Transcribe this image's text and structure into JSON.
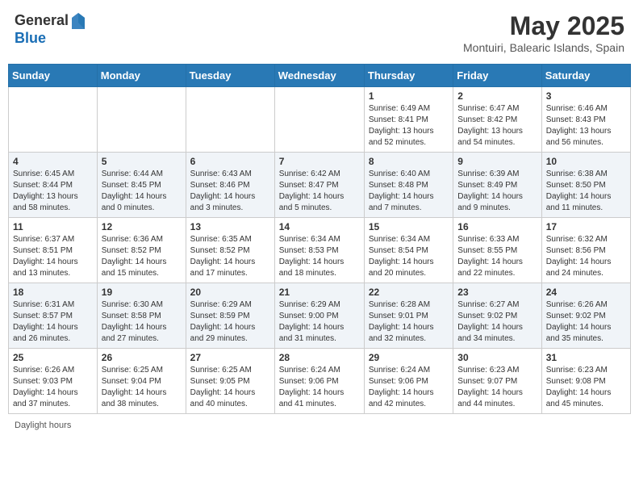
{
  "header": {
    "logo_general": "General",
    "logo_blue": "Blue",
    "month_title": "May 2025",
    "subtitle": "Montuiri, Balearic Islands, Spain"
  },
  "days_of_week": [
    "Sunday",
    "Monday",
    "Tuesday",
    "Wednesday",
    "Thursday",
    "Friday",
    "Saturday"
  ],
  "weeks": [
    [
      {
        "day": "",
        "info": ""
      },
      {
        "day": "",
        "info": ""
      },
      {
        "day": "",
        "info": ""
      },
      {
        "day": "",
        "info": ""
      },
      {
        "day": "1",
        "info": "Sunrise: 6:49 AM\nSunset: 8:41 PM\nDaylight: 13 hours\nand 52 minutes."
      },
      {
        "day": "2",
        "info": "Sunrise: 6:47 AM\nSunset: 8:42 PM\nDaylight: 13 hours\nand 54 minutes."
      },
      {
        "day": "3",
        "info": "Sunrise: 6:46 AM\nSunset: 8:43 PM\nDaylight: 13 hours\nand 56 minutes."
      }
    ],
    [
      {
        "day": "4",
        "info": "Sunrise: 6:45 AM\nSunset: 8:44 PM\nDaylight: 13 hours\nand 58 minutes."
      },
      {
        "day": "5",
        "info": "Sunrise: 6:44 AM\nSunset: 8:45 PM\nDaylight: 14 hours\nand 0 minutes."
      },
      {
        "day": "6",
        "info": "Sunrise: 6:43 AM\nSunset: 8:46 PM\nDaylight: 14 hours\nand 3 minutes."
      },
      {
        "day": "7",
        "info": "Sunrise: 6:42 AM\nSunset: 8:47 PM\nDaylight: 14 hours\nand 5 minutes."
      },
      {
        "day": "8",
        "info": "Sunrise: 6:40 AM\nSunset: 8:48 PM\nDaylight: 14 hours\nand 7 minutes."
      },
      {
        "day": "9",
        "info": "Sunrise: 6:39 AM\nSunset: 8:49 PM\nDaylight: 14 hours\nand 9 minutes."
      },
      {
        "day": "10",
        "info": "Sunrise: 6:38 AM\nSunset: 8:50 PM\nDaylight: 14 hours\nand 11 minutes."
      }
    ],
    [
      {
        "day": "11",
        "info": "Sunrise: 6:37 AM\nSunset: 8:51 PM\nDaylight: 14 hours\nand 13 minutes."
      },
      {
        "day": "12",
        "info": "Sunrise: 6:36 AM\nSunset: 8:52 PM\nDaylight: 14 hours\nand 15 minutes."
      },
      {
        "day": "13",
        "info": "Sunrise: 6:35 AM\nSunset: 8:52 PM\nDaylight: 14 hours\nand 17 minutes."
      },
      {
        "day": "14",
        "info": "Sunrise: 6:34 AM\nSunset: 8:53 PM\nDaylight: 14 hours\nand 18 minutes."
      },
      {
        "day": "15",
        "info": "Sunrise: 6:34 AM\nSunset: 8:54 PM\nDaylight: 14 hours\nand 20 minutes."
      },
      {
        "day": "16",
        "info": "Sunrise: 6:33 AM\nSunset: 8:55 PM\nDaylight: 14 hours\nand 22 minutes."
      },
      {
        "day": "17",
        "info": "Sunrise: 6:32 AM\nSunset: 8:56 PM\nDaylight: 14 hours\nand 24 minutes."
      }
    ],
    [
      {
        "day": "18",
        "info": "Sunrise: 6:31 AM\nSunset: 8:57 PM\nDaylight: 14 hours\nand 26 minutes."
      },
      {
        "day": "19",
        "info": "Sunrise: 6:30 AM\nSunset: 8:58 PM\nDaylight: 14 hours\nand 27 minutes."
      },
      {
        "day": "20",
        "info": "Sunrise: 6:29 AM\nSunset: 8:59 PM\nDaylight: 14 hours\nand 29 minutes."
      },
      {
        "day": "21",
        "info": "Sunrise: 6:29 AM\nSunset: 9:00 PM\nDaylight: 14 hours\nand 31 minutes."
      },
      {
        "day": "22",
        "info": "Sunrise: 6:28 AM\nSunset: 9:01 PM\nDaylight: 14 hours\nand 32 minutes."
      },
      {
        "day": "23",
        "info": "Sunrise: 6:27 AM\nSunset: 9:02 PM\nDaylight: 14 hours\nand 34 minutes."
      },
      {
        "day": "24",
        "info": "Sunrise: 6:26 AM\nSunset: 9:02 PM\nDaylight: 14 hours\nand 35 minutes."
      }
    ],
    [
      {
        "day": "25",
        "info": "Sunrise: 6:26 AM\nSunset: 9:03 PM\nDaylight: 14 hours\nand 37 minutes."
      },
      {
        "day": "26",
        "info": "Sunrise: 6:25 AM\nSunset: 9:04 PM\nDaylight: 14 hours\nand 38 minutes."
      },
      {
        "day": "27",
        "info": "Sunrise: 6:25 AM\nSunset: 9:05 PM\nDaylight: 14 hours\nand 40 minutes."
      },
      {
        "day": "28",
        "info": "Sunrise: 6:24 AM\nSunset: 9:06 PM\nDaylight: 14 hours\nand 41 minutes."
      },
      {
        "day": "29",
        "info": "Sunrise: 6:24 AM\nSunset: 9:06 PM\nDaylight: 14 hours\nand 42 minutes."
      },
      {
        "day": "30",
        "info": "Sunrise: 6:23 AM\nSunset: 9:07 PM\nDaylight: 14 hours\nand 44 minutes."
      },
      {
        "day": "31",
        "info": "Sunrise: 6:23 AM\nSunset: 9:08 PM\nDaylight: 14 hours\nand 45 minutes."
      }
    ]
  ],
  "footer": {
    "note": "Daylight hours"
  }
}
